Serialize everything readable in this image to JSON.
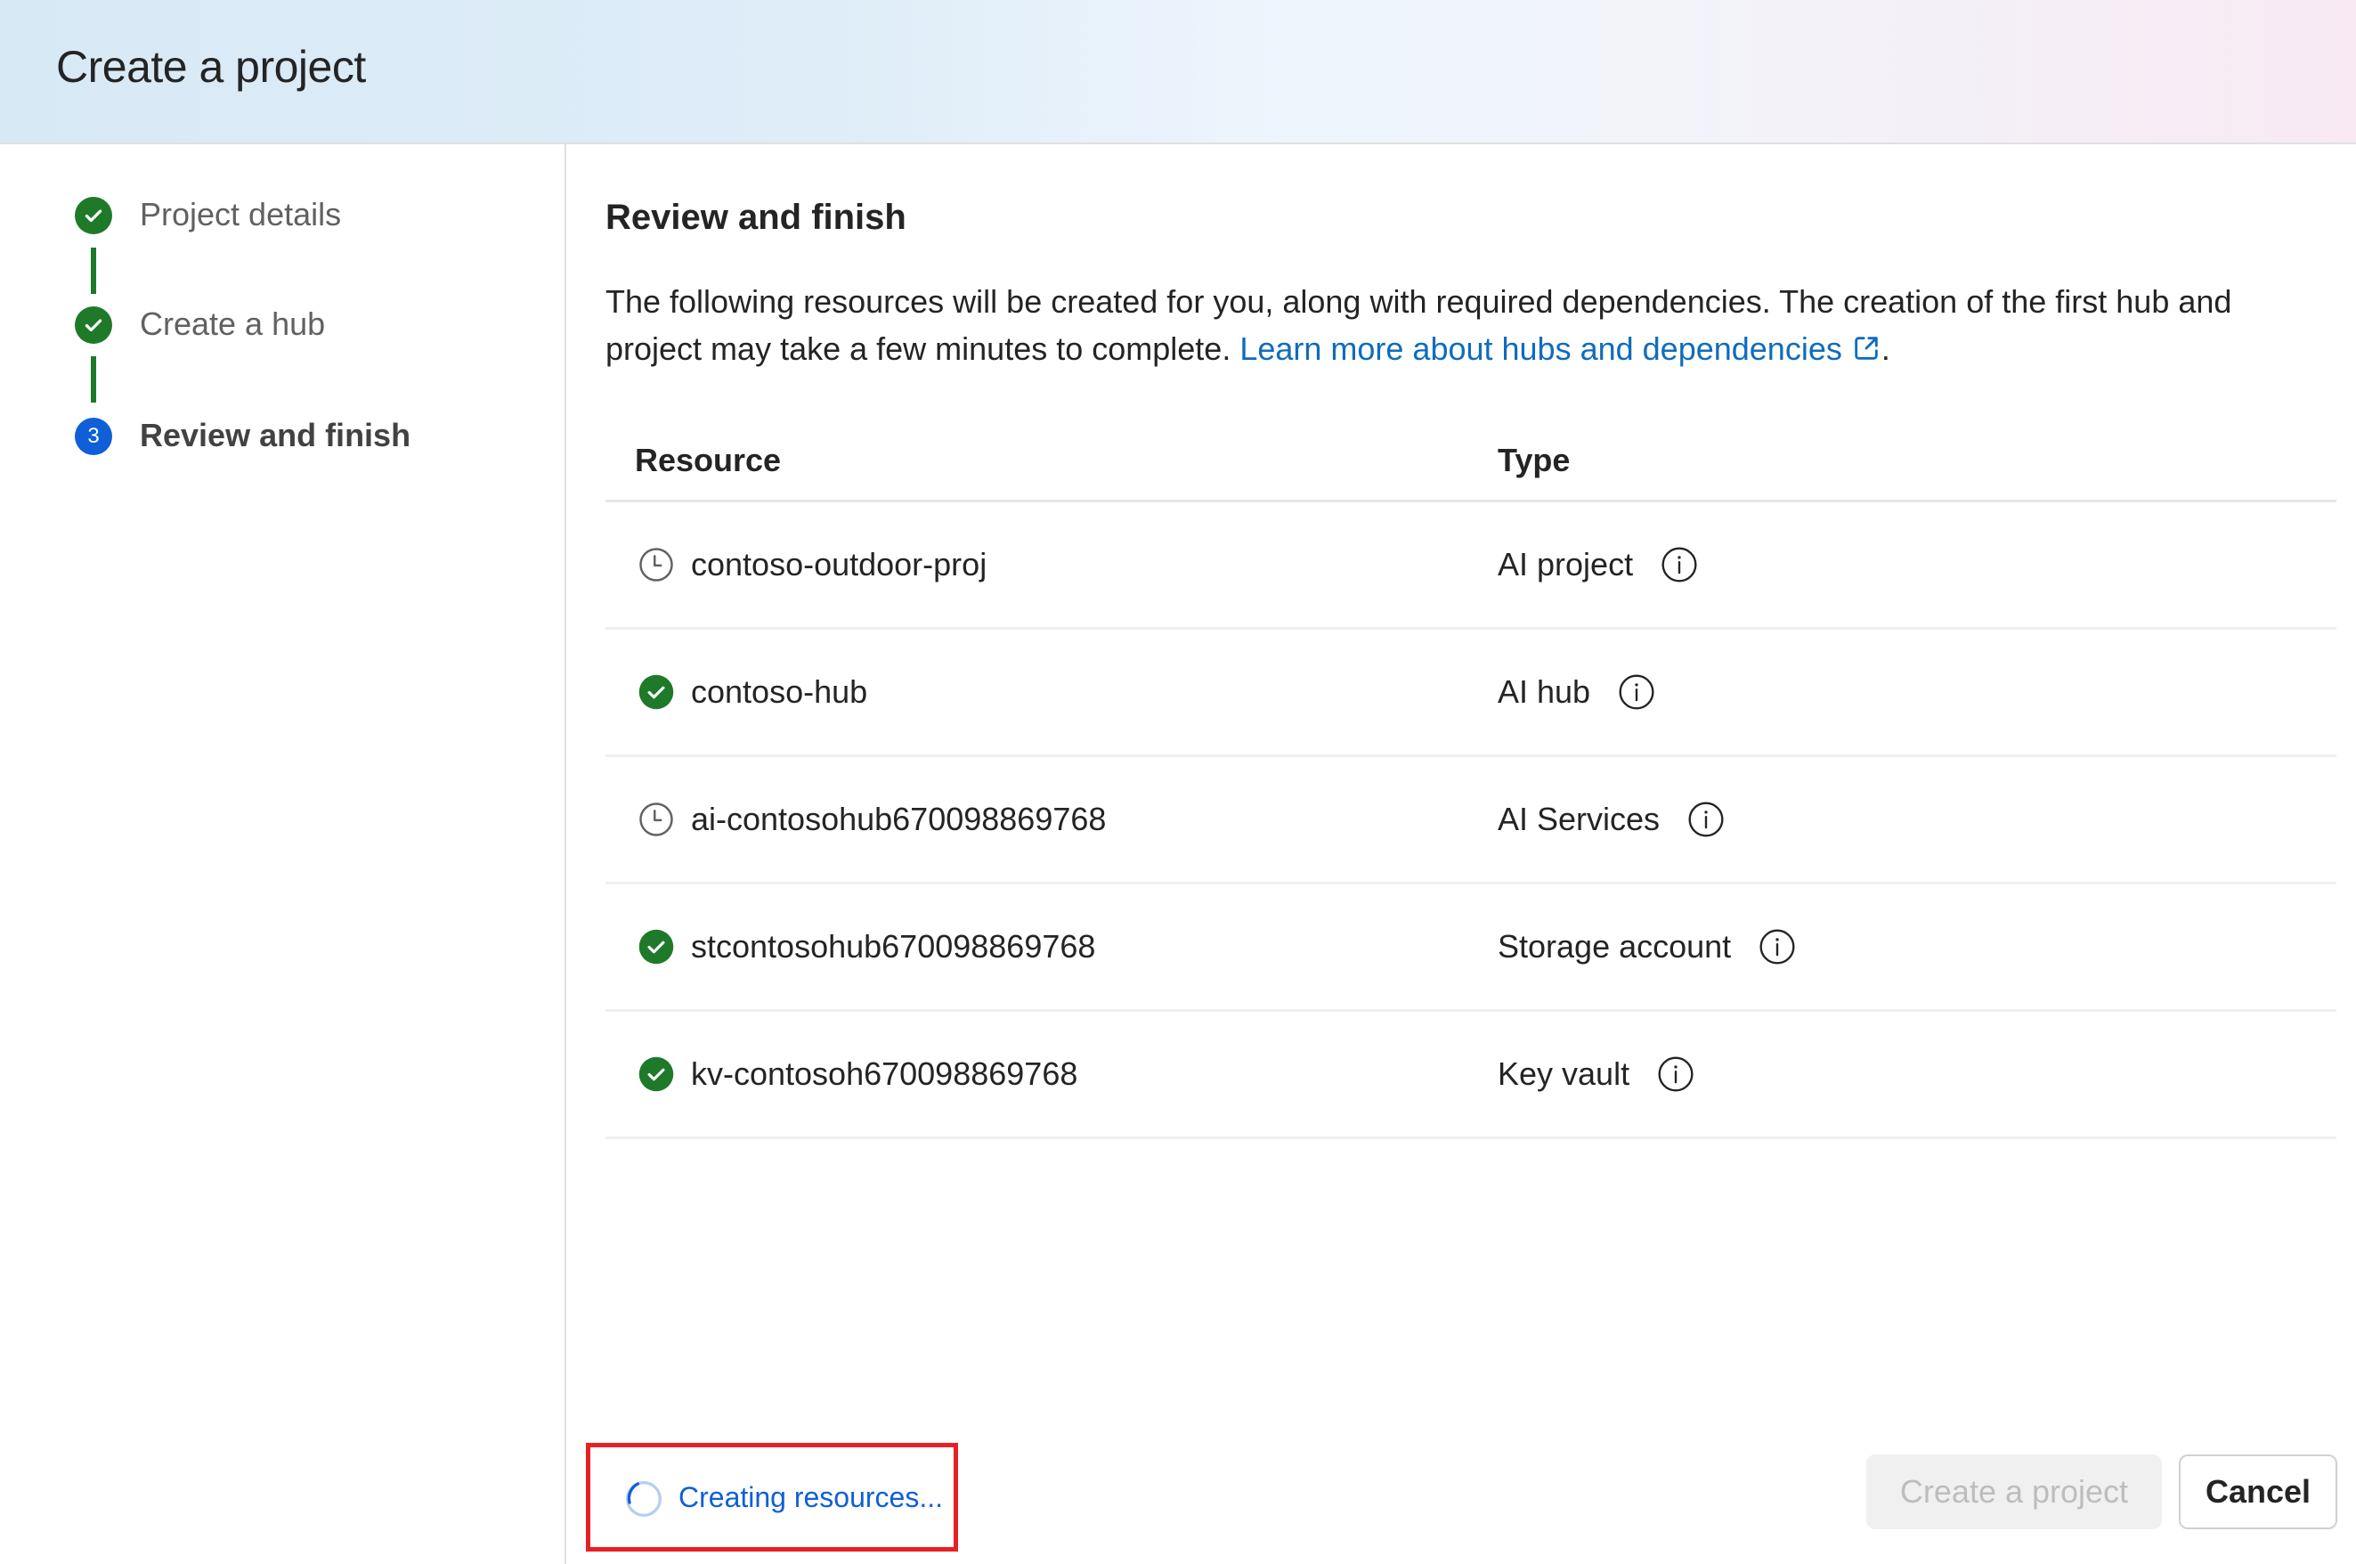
{
  "header": {
    "title": "Create a project"
  },
  "wizard": {
    "steps": [
      {
        "label": "Project details",
        "status": "completed",
        "icon": "checkmark-circle-icon"
      },
      {
        "label": "Create a hub",
        "status": "completed",
        "icon": "checkmark-circle-icon"
      },
      {
        "label": "Review and finish",
        "status": "current",
        "number": "3"
      }
    ]
  },
  "main": {
    "title": "Review and finish",
    "description": "The following resources will be created for you, along with required dependencies. The creation of the first hub and project may take a few minutes to complete.",
    "link_text": "Learn more about hubs and dependencies",
    "link_icon": "open-external-icon",
    "link_suffix": "."
  },
  "table": {
    "columns": [
      "Resource",
      "Type"
    ],
    "rows": [
      {
        "resource": "contoso-outdoor-proj",
        "type": "AI project",
        "status": "pending",
        "status_icon": "clock-icon"
      },
      {
        "resource": "contoso-hub",
        "type": "AI hub",
        "status": "completed",
        "status_icon": "checkmark-circle-icon"
      },
      {
        "resource": "ai-contosohub670098869768",
        "type": "AI Services",
        "status": "pending",
        "status_icon": "clock-icon"
      },
      {
        "resource": "stcontosohub670098869768",
        "type": "Storage account",
        "status": "completed",
        "status_icon": "checkmark-circle-icon"
      },
      {
        "resource": "kv-contosoh670098869768",
        "type": "Key vault",
        "status": "completed",
        "status_icon": "checkmark-circle-icon"
      }
    ]
  },
  "footer": {
    "status_text": "Creating resources...",
    "create_button": "Create a project",
    "create_button_disabled": true,
    "cancel_button": "Cancel"
  },
  "colors": {
    "success": "#1e7a29",
    "accent": "#0f5fd8",
    "link": "#0f6cbd",
    "highlight_box": "#e81f25",
    "disabled_bg": "#f0f0f0",
    "disabled_text": "#bdbdbd"
  }
}
